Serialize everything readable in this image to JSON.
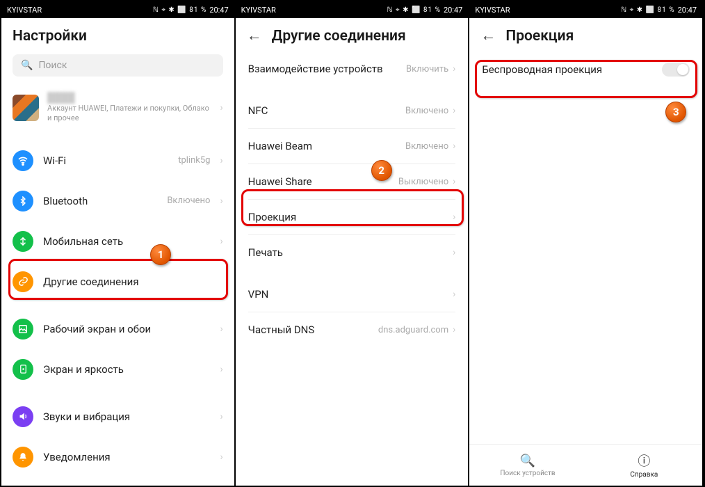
{
  "status": {
    "carrier": "KYIVSTAR",
    "icons": "ℕ ⌖ ✱ ⬜ 81 %",
    "battery": "81 %",
    "time": "20:47"
  },
  "screen1": {
    "title": "Настройки",
    "search_placeholder": "Поиск",
    "account": {
      "name": "████",
      "sub": "Аккаунт HUAWEI, Платежи и покупки, Облако и прочее"
    },
    "wifi": {
      "label": "Wi-Fi",
      "value": "tplink5g"
    },
    "bluetooth": {
      "label": "Bluetooth",
      "value": "Включено"
    },
    "mobile": {
      "label": "Мобильная сеть",
      "value": ""
    },
    "other": {
      "label": "Другие соединения",
      "value": ""
    },
    "wallpaper": {
      "label": "Рабочий экран и обои",
      "value": ""
    },
    "display": {
      "label": "Экран и яркость",
      "value": ""
    },
    "sound": {
      "label": "Звуки и вибрация",
      "value": ""
    },
    "notif": {
      "label": "Уведомления",
      "value": ""
    }
  },
  "screen2": {
    "title": "Другие соединения",
    "multi": {
      "label": "Взаимодействие устройств",
      "value": "Включить"
    },
    "nfc": {
      "label": "NFC",
      "value": "Включено"
    },
    "beam": {
      "label": "Huawei Beam",
      "value": "Включено"
    },
    "share": {
      "label": "Huawei Share",
      "value": "Выключено"
    },
    "proj": {
      "label": "Проекция",
      "value": ""
    },
    "print": {
      "label": "Печать",
      "value": ""
    },
    "vpn": {
      "label": "VPN",
      "value": ""
    },
    "dns": {
      "label": "Частный DNS",
      "value": "dns.adguard.com"
    }
  },
  "screen3": {
    "title": "Проекция",
    "wireless": {
      "label": "Беспроводная проекция"
    },
    "nav": {
      "search": "Поиск устройств",
      "help": "Справка"
    }
  },
  "steps": {
    "s1": "1",
    "s2": "2",
    "s3": "3"
  }
}
